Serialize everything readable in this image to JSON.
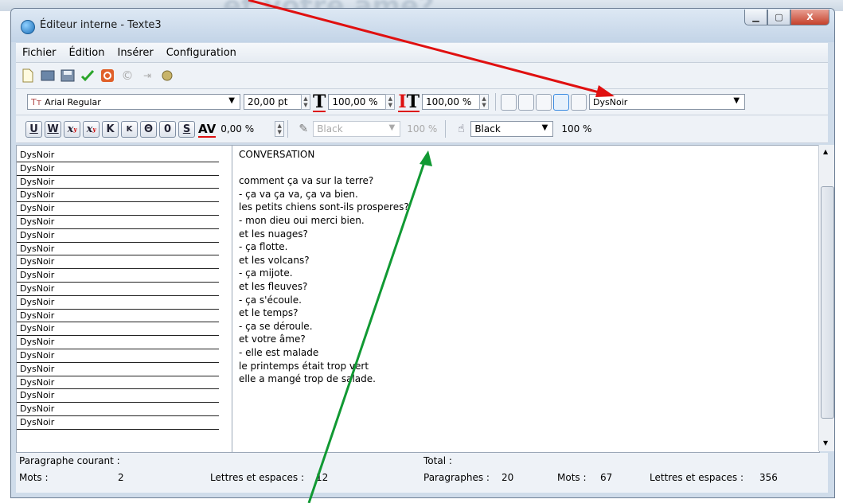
{
  "background": {
    "blur_text": "et votre âme?"
  },
  "window": {
    "title": "Éditeur interne - Texte3",
    "buttons": {
      "minimize": "▁",
      "maximize": "▢",
      "close": "X"
    }
  },
  "menu": [
    "Fichier",
    "Édition",
    "Insérer",
    "Configuration"
  ],
  "format_toolbar": {
    "font": "Arial Regular",
    "size": "20,00 pt",
    "scale_v": "100,00 %",
    "scale_h": "100,00 %",
    "style": "DysNoir"
  },
  "char_toolbar": {
    "buttons": [
      "U",
      "W",
      "x",
      "x",
      "K",
      "K",
      "Θ",
      "0",
      "S",
      "AV"
    ],
    "spacing": "0,00 %",
    "text_color": "Black",
    "text_opacity": "100 %",
    "bg_color": "Black",
    "bg_opacity": "100 %"
  },
  "styles_list": [
    "DysNoir",
    "DysNoir",
    "DysNoir",
    "DysNoir",
    "DysNoir",
    "DysNoir",
    "DysNoir",
    "DysNoir",
    "DysNoir",
    "DysNoir",
    "DysNoir",
    "DysNoir",
    "DysNoir",
    "DysNoir",
    "DysNoir",
    "DysNoir",
    "DysNoir",
    "DysNoir",
    "DysNoir",
    "DysNoir",
    "DysNoir"
  ],
  "text_lines": [
    "CONVERSATION",
    "",
    "comment ça va sur la terre?",
    "- ça va ça va, ça va bien.",
    "les petits chiens sont-ils prosperes?",
    "- mon dieu oui merci bien.",
    "et les nuages?",
    "- ça flotte.",
    "et les volcans?",
    "- ça mijote.",
    "et les fleuves?",
    "- ça s'écoule.",
    "et le temps?",
    "- ça se déroule.",
    "et votre âme?",
    "- elle est malade",
    "le printemps était trop vert",
    "elle a mangé trop de salade."
  ],
  "status": {
    "current_label": "Paragraphe courant :",
    "words_label": "Mots :",
    "words_value": "2",
    "letters_label": "Lettres et espaces :",
    "letters_value": "12",
    "total_label": "Total :",
    "paragraphs_label": "Paragraphes :",
    "paragraphs_value": "20",
    "total_words_label": "Mots :",
    "total_words_value": "67",
    "total_letters_label": "Lettres et espaces :",
    "total_letters_value": "356"
  },
  "annotations": {
    "red_arrow_color": "#e01010",
    "green_arrow_color": "#119933"
  }
}
